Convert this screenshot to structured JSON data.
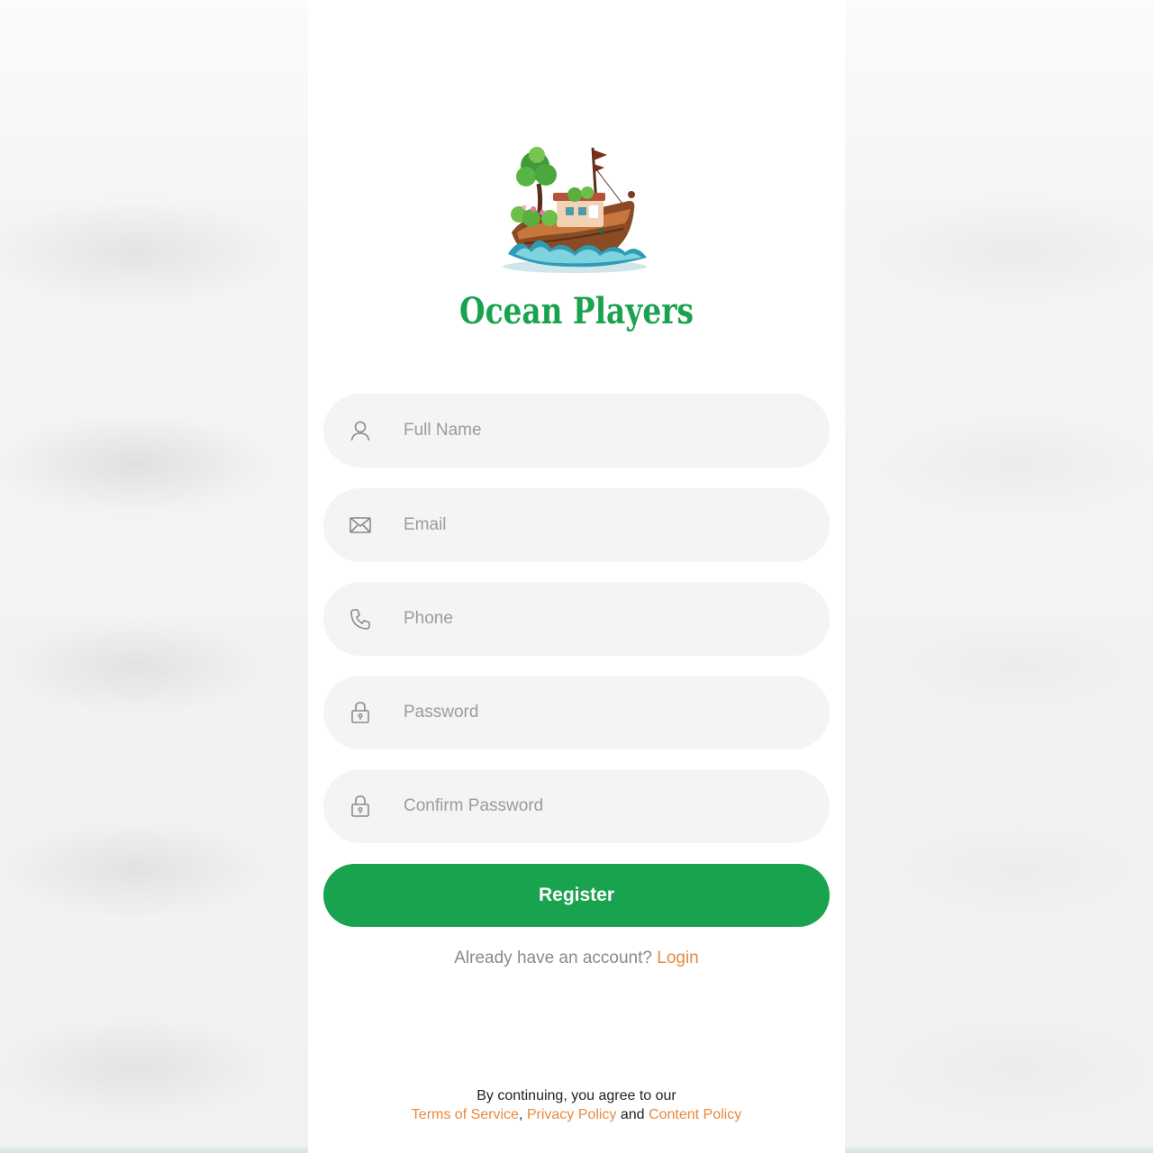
{
  "app": {
    "brand_name": "Ocean Players",
    "brand_color": "#1aa34e",
    "accent_color": "#e8893e",
    "logo_icon": "boat-with-tree-logo"
  },
  "form": {
    "fields": [
      {
        "name": "full-name",
        "placeholder": "Full Name",
        "value": "",
        "icon": "user-icon"
      },
      {
        "name": "email",
        "placeholder": "Email",
        "value": "",
        "icon": "envelope-icon"
      },
      {
        "name": "phone",
        "placeholder": "Phone",
        "value": "",
        "icon": "phone-icon"
      },
      {
        "name": "password",
        "placeholder": "Password",
        "value": "",
        "icon": "lock-icon"
      },
      {
        "name": "confirm-password",
        "placeholder": "Confirm Password",
        "value": "",
        "icon": "lock-icon"
      }
    ],
    "submit_label": "Register"
  },
  "login_prompt": {
    "text": "Already have an account?",
    "link_label": "Login"
  },
  "terms": {
    "intro": "By continuing, you agree to our",
    "tos_label": "Terms of Service",
    "comma": ",",
    "privacy_label": "Privacy Policy",
    "and": "and",
    "content_label": "Content Policy"
  }
}
